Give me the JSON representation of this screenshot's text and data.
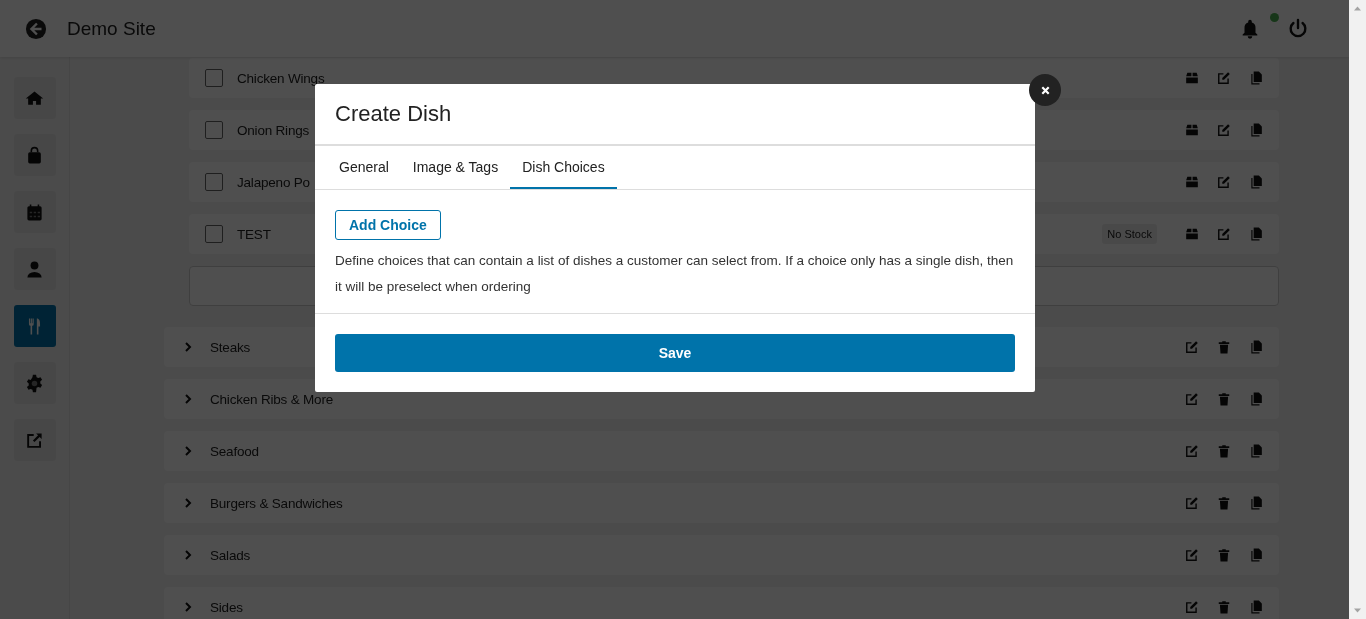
{
  "header": {
    "title": "Demo Site",
    "notification_unread": true
  },
  "sidebar": {
    "items": [
      {
        "kind": "home",
        "selected": false
      },
      {
        "kind": "bag",
        "selected": false
      },
      {
        "kind": "calendar",
        "selected": false
      },
      {
        "kind": "user",
        "selected": false
      },
      {
        "kind": "utensils",
        "selected": true
      },
      {
        "kind": "gear",
        "selected": false
      },
      {
        "kind": "external",
        "selected": false
      }
    ]
  },
  "dishes": [
    {
      "name": "Chicken Wings",
      "checked": false
    },
    {
      "name": "Onion Rings",
      "checked": false
    },
    {
      "name": "Jalapeno Po",
      "checked": false
    },
    {
      "name": "TEST",
      "checked": false,
      "badge": "No Stock"
    }
  ],
  "categories": [
    {
      "name": "Steaks",
      "expanded": false
    },
    {
      "name": "Chicken Ribs & More",
      "expanded": false
    },
    {
      "name": "Seafood",
      "expanded": false
    },
    {
      "name": "Burgers & Sandwiches",
      "expanded": false
    },
    {
      "name": "Salads",
      "expanded": false
    },
    {
      "name": "Sides",
      "expanded": false
    }
  ],
  "modal": {
    "title": "Create Dish",
    "tabs": [
      {
        "label": "General",
        "selected": false
      },
      {
        "label": "Image & Tags",
        "selected": false
      },
      {
        "label": "Dish Choices",
        "selected": true
      }
    ],
    "add_button": "Add Choice",
    "description": "Define choices that can contain a list of dishes a customer can select from. If a choice only has a single dish, then it will be preselect when ordering",
    "save_button": "Save"
  }
}
